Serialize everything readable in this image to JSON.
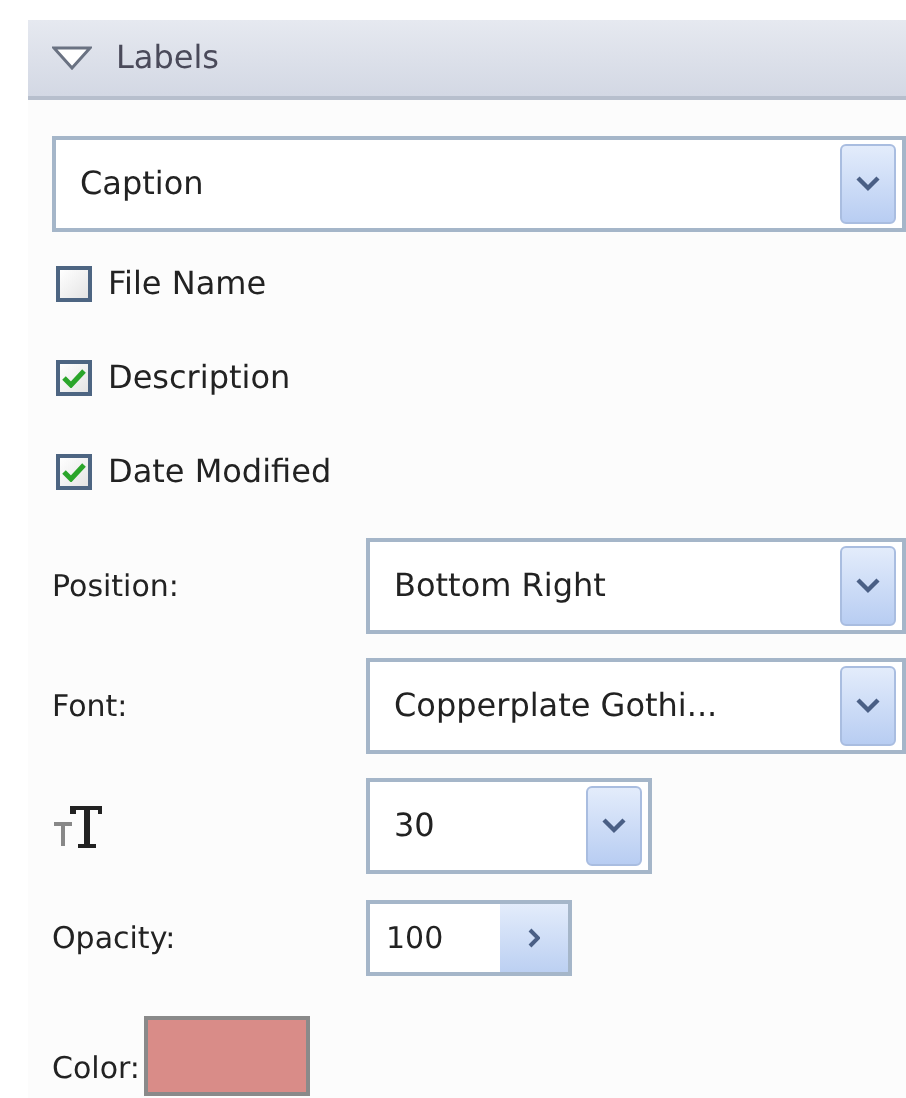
{
  "section": {
    "title": "Labels",
    "expanded": true
  },
  "label_type": {
    "value": "Caption"
  },
  "checkboxes": [
    {
      "label": "File Name",
      "checked": false
    },
    {
      "label": "Description",
      "checked": true
    },
    {
      "label": "Date Modified",
      "checked": true
    }
  ],
  "position": {
    "label": "Position:",
    "value": "Bottom Right"
  },
  "font": {
    "label": "Font:",
    "value": "Copperplate Gothi..."
  },
  "size": {
    "value": "30"
  },
  "opacity": {
    "label": "Opacity:",
    "value": "100"
  },
  "color": {
    "label": "Color:",
    "color": "#d98c88"
  }
}
